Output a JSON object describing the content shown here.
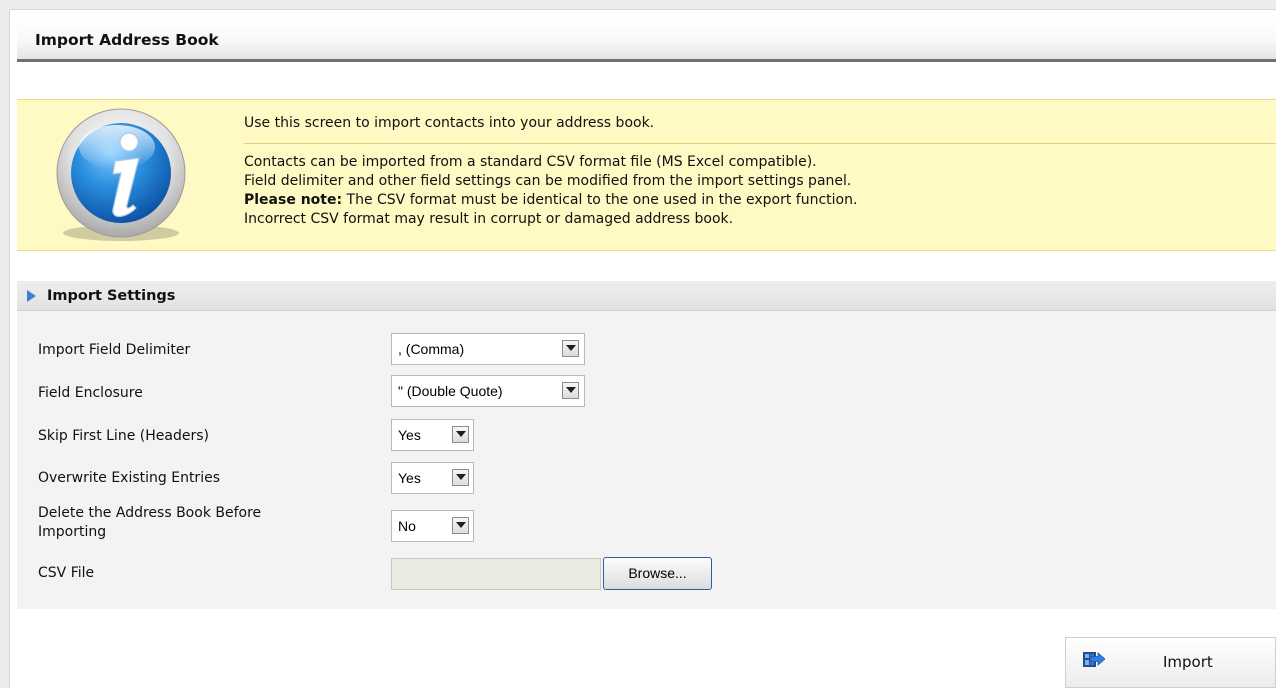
{
  "page": {
    "title": "Import Address Book"
  },
  "info": {
    "icon": "info-icon",
    "line1": "Use this screen to import contacts into your address book.",
    "para1": "Contacts can be imported from a standard CSV format file (MS Excel compatible).",
    "para2": "Field delimiter and other field settings can be modified from the import settings panel.",
    "note_label": "Please note:",
    "note_text": " The CSV format must be identical to the one used in the export function.",
    "para4": "Incorrect CSV format may result in corrupt or damaged address book."
  },
  "settings": {
    "title": "Import Settings",
    "rows": [
      {
        "label": "Import Field Delimiter",
        "value": ", (Comma)"
      },
      {
        "label": "Field Enclosure",
        "value": "\" (Double Quote)"
      },
      {
        "label": "Skip First Line (Headers)",
        "value": "Yes"
      },
      {
        "label": "Overwrite Existing Entries",
        "value": "Yes"
      },
      {
        "label_line1": "Delete the Address Book Before",
        "label_line2": "Importing",
        "value": "No"
      }
    ],
    "csv_label": "CSV File",
    "csv_value": "",
    "browse_label": "Browse..."
  },
  "actions": {
    "import_label": "Import"
  },
  "colors": {
    "info_bg": "#fff9c4",
    "accent_blue": "#3f7fd4"
  }
}
